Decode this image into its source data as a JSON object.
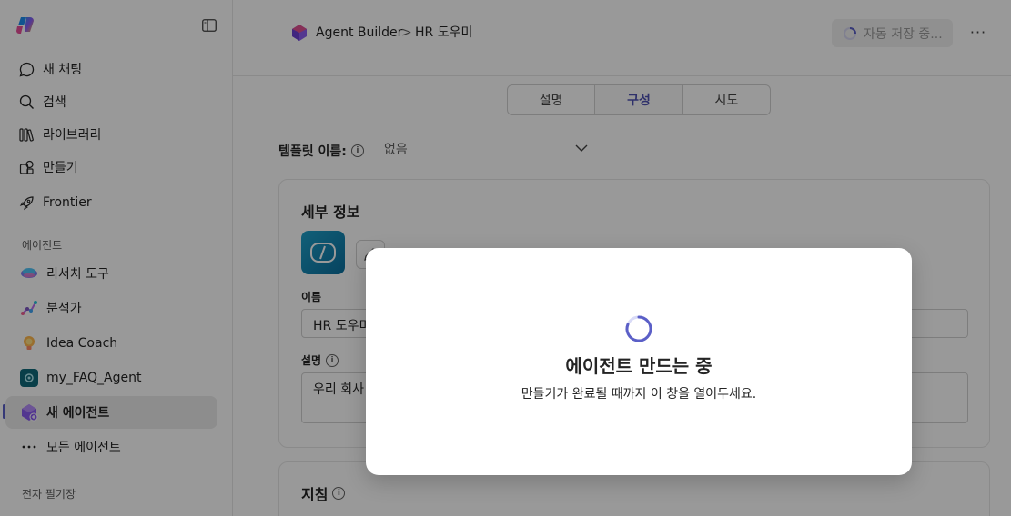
{
  "sidebar": {
    "nav": [
      {
        "label": "새 채팅",
        "icon": "chat-bubble-icon"
      },
      {
        "label": "검색",
        "icon": "search-icon"
      },
      {
        "label": "라이브러리",
        "icon": "library-icon"
      },
      {
        "label": "만들기",
        "icon": "create-icon"
      },
      {
        "label": "Frontier",
        "icon": "rocket-icon"
      }
    ],
    "agents_section": "에이전트",
    "agents": [
      {
        "label": "리서치 도구",
        "icon": "research-icon"
      },
      {
        "label": "분석가",
        "icon": "analyst-icon"
      },
      {
        "label": "Idea Coach",
        "icon": "lightbulb-icon"
      },
      {
        "label": "my_FAQ_Agent",
        "icon": "faq-agent-icon"
      },
      {
        "label": "새 에이전트",
        "icon": "new-agent-icon"
      },
      {
        "label": "모든 에이전트",
        "icon": "more-icon"
      }
    ],
    "notebook_section": "전자 필기장"
  },
  "header": {
    "breadcrumb_root": "Agent Builder",
    "breadcrumb_separator": ">",
    "breadcrumb_current": "HR 도우미",
    "autosave": "자동 저장 중...",
    "more": "···"
  },
  "tabs": [
    {
      "label": "설명"
    },
    {
      "label": "구성"
    },
    {
      "label": "시도"
    }
  ],
  "template": {
    "label": "템플릿 이름:",
    "value": "없음"
  },
  "details": {
    "title": "세부 정보",
    "name_label": "이름",
    "name_value": "HR 도우미",
    "desc_label": "설명",
    "desc_value": "우리 회사"
  },
  "instructions": {
    "title": "지침"
  },
  "dialog": {
    "title": "에이전트 만드는 중",
    "subtitle": "만들기가 완료될 때까지 이 창을 열어두세요."
  },
  "colors": {
    "accent": "#5b5fc7",
    "active_tab": "#4f52b2",
    "overlay": "rgba(0,0,0,0.4)"
  }
}
